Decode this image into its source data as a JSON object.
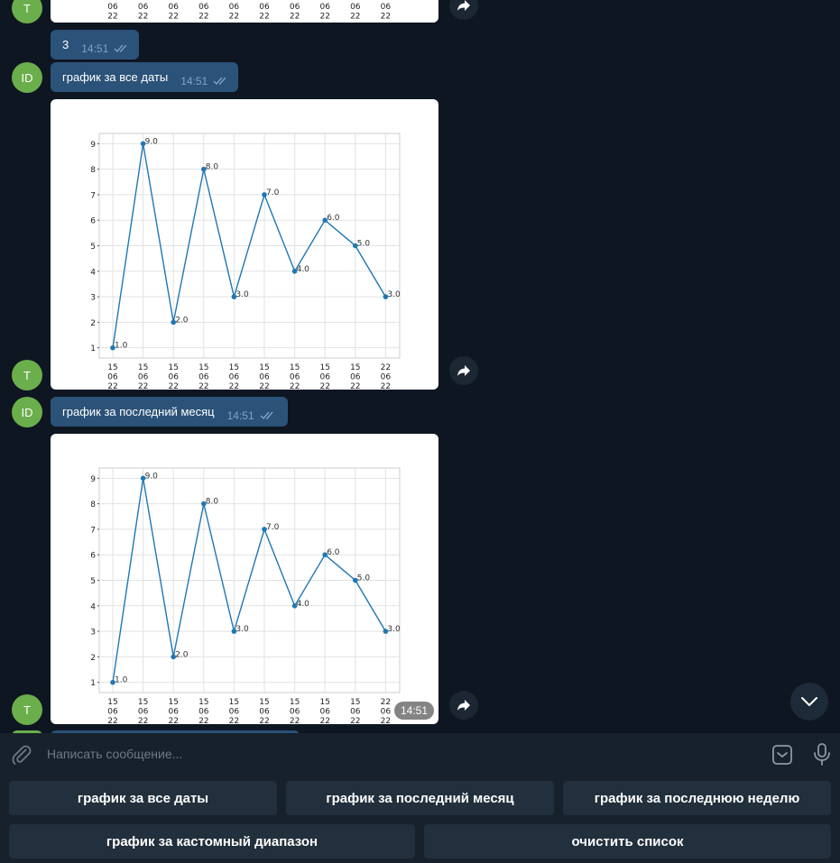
{
  "messages": [
    {
      "text": "3",
      "time": "14:51",
      "read": true
    },
    {
      "avatar": "ID",
      "text": "график за все даты",
      "time": "14:51",
      "read": true
    },
    {
      "avatar": "ID",
      "text": "график за последний месяц",
      "time": "14:51",
      "read": true
    }
  ],
  "bot_avatar": "T",
  "user_avatar": "ID",
  "photo2": {
    "time": "14:51"
  },
  "chart_data": [
    {
      "type": "line",
      "title": "",
      "xlabel": "",
      "ylabel": "",
      "x": [
        "15\n06\n22",
        "15\n06\n22",
        "15\n06\n22",
        "15\n06\n22",
        "15\n06\n22",
        "15\n06\n22",
        "15\n06\n22",
        "15\n06\n22",
        "15\n06\n22",
        "22\n06\n22"
      ],
      "y": [
        1,
        9,
        2,
        8,
        3,
        7,
        4,
        6,
        5,
        3
      ],
      "data_labels": [
        "1.0",
        "9.0",
        "2.0",
        "8.0",
        "3.0",
        "7.0",
        "4.0",
        "6.0",
        "5.0",
        "3.0"
      ],
      "yticks": [
        1,
        2,
        3,
        4,
        5,
        6,
        7,
        8,
        9
      ],
      "ylim": [
        0.6,
        9.4
      ],
      "grid": true,
      "color": "#1f77b4"
    },
    {
      "type": "line",
      "title": "",
      "xlabel": "",
      "ylabel": "",
      "x": [
        "15\n06\n22",
        "15\n06\n22",
        "15\n06\n22",
        "15\n06\n22",
        "15\n06\n22",
        "15\n06\n22",
        "15\n06\n22",
        "15\n06\n22",
        "15\n06\n22",
        "22\n06\n22"
      ],
      "y": [
        1,
        9,
        2,
        8,
        3,
        7,
        4,
        6,
        5,
        3
      ],
      "data_labels": [
        "1.0",
        "9.0",
        "2.0",
        "8.0",
        "3.0",
        "7.0",
        "4.0",
        "6.0",
        "5.0",
        "3.0"
      ],
      "yticks": [
        1,
        2,
        3,
        4,
        5,
        6,
        7,
        8,
        9
      ],
      "ylim": [
        0.6,
        9.4
      ],
      "grid": true,
      "color": "#1f77b4"
    }
  ],
  "partial_top_ticks": [
    "06\n22",
    "06\n22",
    "06\n22",
    "06\n22",
    "06\n22",
    "06\n22",
    "06\n22",
    "06\n22",
    "06\n22",
    "06\n22"
  ],
  "input": {
    "placeholder": "Написать сообщение..."
  },
  "keyboard": {
    "row1": [
      "график за все даты",
      "график за последний месяц",
      "график за последнюю неделю"
    ],
    "row2": [
      "график за кастомный диапазон",
      "очистить список"
    ]
  },
  "colors": {
    "bg": "#0e1621",
    "bubble": "#2b5278",
    "panel": "#17212b",
    "button": "#222f3c",
    "avatar": "#6bae4c",
    "line": "#1f77b4"
  }
}
